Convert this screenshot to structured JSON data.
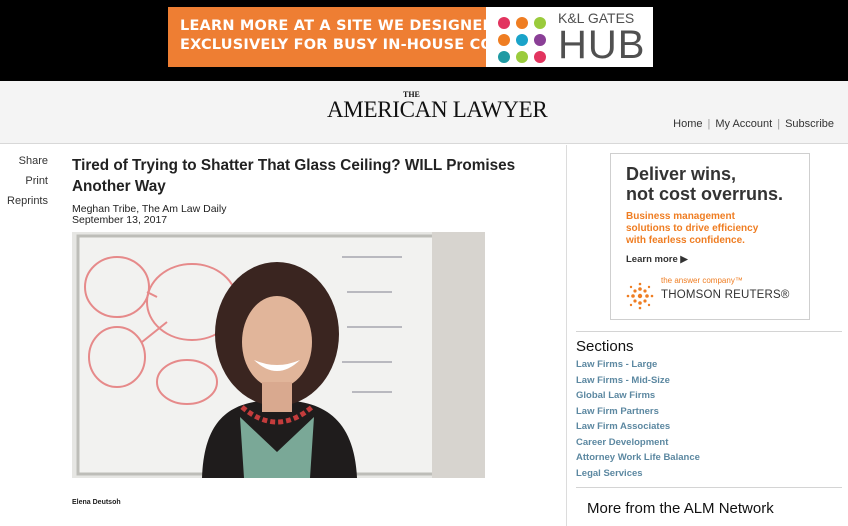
{
  "ad_top": {
    "line1": "LEARN MORE AT A SITE WE DESIGNED",
    "line2": "EXCLUSIVELY FOR BUSY IN-HOUSE COUNSEL.",
    "brand_small": "K&L GATES",
    "brand_big": "HUB",
    "dot_colors": [
      "#e2345f",
      "#ef7d22",
      "#9acb3c",
      "#ef7d22",
      "#1aa3c9",
      "#8a3f96",
      "#1f9aa3",
      "#9acb3c",
      "#e2345f"
    ]
  },
  "header": {
    "logo_the": "THE",
    "logo_main": "AMERICAN LAWYER",
    "nav": [
      "Home",
      "My Account",
      "Subscribe"
    ]
  },
  "share": {
    "items": [
      "Share",
      "Print",
      "Reprints"
    ]
  },
  "article": {
    "title": "Tired of Trying to Shatter That Glass Ceiling? WILL Promises Another Way",
    "author": "Meghan Tribe, The Am Law Daily",
    "date": "September 13, 2017",
    "caption": "Elena Deutsoh"
  },
  "ad_side": {
    "headline_1": "Deliver wins,",
    "headline_2": "not cost overruns.",
    "sub_1": "Business management",
    "sub_2": "solutions to drive efficiency",
    "sub_3": "with fearless confidence.",
    "cta": "Learn more",
    "tagline": "the answer company™",
    "company": "THOMSON REUTERS®"
  },
  "sections": {
    "heading": "Sections",
    "items": [
      "Law Firms - Large",
      "Law Firms - Mid-Size",
      "Global Law Firms",
      "Law Firm Partners",
      "Law Firm Associates",
      "Career Development",
      "Attorney Work Life Balance",
      "Legal Services"
    ]
  },
  "more_network": {
    "heading": "More from the ALM Network"
  },
  "colors": {
    "accent_orange": "#ee7e33",
    "link_blue": "#5c88a1",
    "header_bg": "#f4f4f4"
  }
}
